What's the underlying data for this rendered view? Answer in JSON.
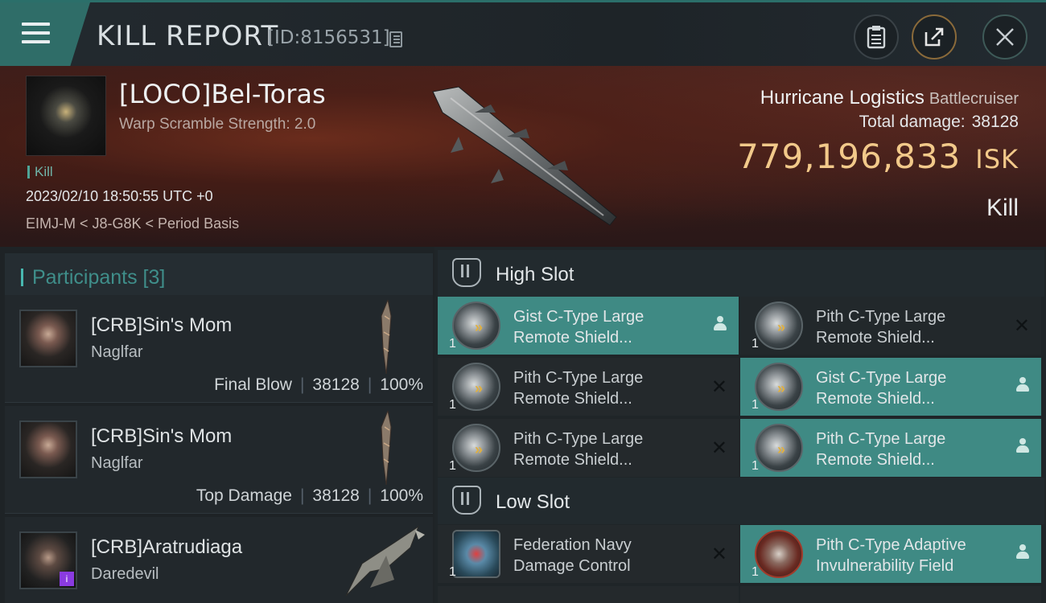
{
  "header": {
    "title": "KILL REPORT",
    "id": "[ID:8156531]"
  },
  "victim": {
    "name": "[LOCO]Bel-Toras",
    "warp_scramble": "Warp Scramble Strength: 2.0",
    "tag": "Kill",
    "time": "2023/02/10 18:50:55 UTC +0",
    "location": "EIMJ-M < J8-G8K < Period Basis",
    "ship": "Hurricane Logistics",
    "ship_class": "Battlecruiser",
    "total_damage_label": "Total damage:",
    "total_damage": "38128",
    "isk_value": "779,196,833",
    "isk_unit": "ISK",
    "result": "Kill"
  },
  "participants": {
    "title": "Participants [3]",
    "rows": [
      {
        "name": "[CRB]Sin's Mom",
        "ship": "Naglfar",
        "role": "Final Blow",
        "damage": "38128",
        "percent": "100%"
      },
      {
        "name": "[CRB]Sin's Mom",
        "ship": "Naglfar",
        "role": "Top Damage",
        "damage": "38128",
        "percent": "100%"
      },
      {
        "name": "[CRB]Aratrudiaga",
        "ship": "Daredevil",
        "badge": "i"
      }
    ]
  },
  "fitting": {
    "high_slot_title": "High Slot",
    "low_slot_title": "Low Slot",
    "high": [
      {
        "line1": "Gist C-Type Large",
        "line2": "Remote Shield...",
        "qty": "1",
        "status": "dropped"
      },
      {
        "line1": "Pith C-Type Large",
        "line2": "Remote Shield...",
        "qty": "1",
        "status": "destroyed"
      },
      {
        "line1": "Pith C-Type Large",
        "line2": "Remote Shield...",
        "qty": "1",
        "status": "destroyed"
      },
      {
        "line1": "Gist C-Type Large",
        "line2": "Remote Shield...",
        "qty": "1",
        "status": "dropped"
      },
      {
        "line1": "Pith C-Type Large",
        "line2": "Remote Shield...",
        "qty": "1",
        "status": "destroyed"
      },
      {
        "line1": "Pith C-Type Large",
        "line2": "Remote Shield...",
        "qty": "1",
        "status": "dropped"
      }
    ],
    "low": [
      {
        "line1": "Federation Navy",
        "line2": "Damage Control",
        "qty": "1",
        "status": "destroyed"
      },
      {
        "line1": "Pith C-Type Adaptive",
        "line2": "Invulnerability Field",
        "qty": "1",
        "status": "dropped"
      }
    ]
  },
  "icons": {
    "destroyed": "close-icon",
    "dropped": "person-icon"
  },
  "colors": {
    "accent": "#3f8a84",
    "isk": "#f2c98a"
  }
}
